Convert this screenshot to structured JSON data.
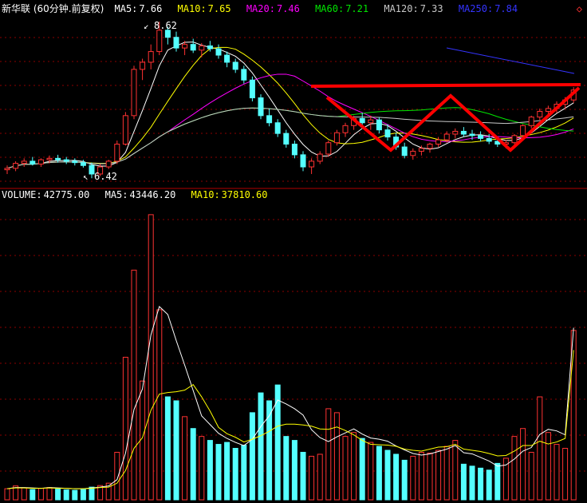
{
  "colors": {
    "background": "#000000",
    "up": "#ff3232",
    "down": "#54ffff",
    "ma5": "#ffffff",
    "ma10": "#ffff00",
    "ma20": "#ff00ff",
    "ma60": "#00e600",
    "ma120": "#c8c8c8",
    "ma250": "#3434ff",
    "grid": "#8b0000",
    "annotation": "#ff0000"
  },
  "header": {
    "title": "新华联 (60分钟.前复权)",
    "ma5_label": "MA5:",
    "ma5_value": "7.66",
    "ma10_label": "MA10:",
    "ma10_value": "7.65",
    "ma20_label": "MA20:",
    "ma20_value": "7.46",
    "ma60_label": "MA60:",
    "ma60_value": "7.21",
    "ma120_label": "MA120:",
    "ma120_value": "7.33",
    "ma250_label": "MA250:",
    "ma250_value": "7.84",
    "corner_icon": "diamond-icon"
  },
  "volume_header": {
    "volume_label": "VOLUME:",
    "volume_value": "42775.00",
    "ma5_label": "MA5:",
    "ma5_value": "43446.20",
    "ma10_label": "MA10:",
    "ma10_value": "37810.60"
  },
  "chart_data": {
    "type": "candlestick",
    "price_range": [
      6.3,
      8.7
    ],
    "volume_range": [
      0,
      75000
    ],
    "grid": true,
    "annotations": {
      "high_label": "8.62",
      "low_label": "6.42"
    },
    "ohlc": [
      [
        6.54,
        6.6,
        6.48,
        6.56
      ],
      [
        6.56,
        6.66,
        6.52,
        6.63
      ],
      [
        6.63,
        6.7,
        6.58,
        6.66
      ],
      [
        6.66,
        6.72,
        6.6,
        6.62
      ],
      [
        6.62,
        6.7,
        6.58,
        6.68
      ],
      [
        6.68,
        6.74,
        6.63,
        6.7
      ],
      [
        6.7,
        6.75,
        6.64,
        6.68
      ],
      [
        6.68,
        6.72,
        6.62,
        6.66
      ],
      [
        6.66,
        6.7,
        6.6,
        6.64
      ],
      [
        6.64,
        6.68,
        6.57,
        6.6
      ],
      [
        6.6,
        6.64,
        6.42,
        6.48
      ],
      [
        6.48,
        6.62,
        6.45,
        6.58
      ],
      [
        6.58,
        6.68,
        6.55,
        6.66
      ],
      [
        6.66,
        6.95,
        6.62,
        6.9
      ],
      [
        6.9,
        7.35,
        6.88,
        7.3
      ],
      [
        7.3,
        8.0,
        7.25,
        7.95
      ],
      [
        7.95,
        8.1,
        7.8,
        8.05
      ],
      [
        8.05,
        8.3,
        7.95,
        8.2
      ],
      [
        8.2,
        8.62,
        8.15,
        8.5
      ],
      [
        8.5,
        8.55,
        8.3,
        8.4
      ],
      [
        8.4,
        8.48,
        8.2,
        8.25
      ],
      [
        8.25,
        8.35,
        8.15,
        8.3
      ],
      [
        8.3,
        8.38,
        8.18,
        8.22
      ],
      [
        8.22,
        8.32,
        8.12,
        8.28
      ],
      [
        8.28,
        8.35,
        8.2,
        8.24
      ],
      [
        8.24,
        8.3,
        8.1,
        8.15
      ],
      [
        8.15,
        8.2,
        7.98,
        8.05
      ],
      [
        8.05,
        8.1,
        7.9,
        7.95
      ],
      [
        7.95,
        8.0,
        7.75,
        7.8
      ],
      [
        7.8,
        7.85,
        7.5,
        7.55
      ],
      [
        7.55,
        7.6,
        7.25,
        7.3
      ],
      [
        7.3,
        7.4,
        7.15,
        7.2
      ],
      [
        7.2,
        7.25,
        7.0,
        7.05
      ],
      [
        7.05,
        7.1,
        6.85,
        6.9
      ],
      [
        6.9,
        6.95,
        6.7,
        6.75
      ],
      [
        6.75,
        6.8,
        6.52,
        6.58
      ],
      [
        6.58,
        6.7,
        6.48,
        6.66
      ],
      [
        6.66,
        6.8,
        6.62,
        6.76
      ],
      [
        6.76,
        6.95,
        6.72,
        6.92
      ],
      [
        6.92,
        7.1,
        6.88,
        7.06
      ],
      [
        7.06,
        7.2,
        7.0,
        7.16
      ],
      [
        7.16,
        7.3,
        7.1,
        7.26
      ],
      [
        7.26,
        7.34,
        7.14,
        7.2
      ],
      [
        7.2,
        7.3,
        7.1,
        7.24
      ],
      [
        7.24,
        7.28,
        7.05,
        7.1
      ],
      [
        7.1,
        7.18,
        6.95,
        7.0
      ],
      [
        7.0,
        7.06,
        6.82,
        6.86
      ],
      [
        6.86,
        6.92,
        6.7,
        6.74
      ],
      [
        6.74,
        6.84,
        6.68,
        6.8
      ],
      [
        6.8,
        6.88,
        6.74,
        6.84
      ],
      [
        6.84,
        6.92,
        6.78,
        6.9
      ],
      [
        6.9,
        7.0,
        6.86,
        6.96
      ],
      [
        6.96,
        7.08,
        6.92,
        7.04
      ],
      [
        7.04,
        7.12,
        6.98,
        7.08
      ],
      [
        7.08,
        7.14,
        7.0,
        7.04
      ],
      [
        7.04,
        7.1,
        6.96,
        7.02
      ],
      [
        7.02,
        7.08,
        6.94,
        6.98
      ],
      [
        6.98,
        7.04,
        6.9,
        6.94
      ],
      [
        6.94,
        6.98,
        6.86,
        6.9
      ],
      [
        6.9,
        6.96,
        6.84,
        6.92
      ],
      [
        6.92,
        7.04,
        6.9,
        7.02
      ],
      [
        7.02,
        7.18,
        7.0,
        7.16
      ],
      [
        7.16,
        7.3,
        7.12,
        7.28
      ],
      [
        7.28,
        7.4,
        7.24,
        7.36
      ],
      [
        7.36,
        7.44,
        7.3,
        7.4
      ],
      [
        7.4,
        7.5,
        7.34,
        7.46
      ],
      [
        7.46,
        7.56,
        7.4,
        7.52
      ],
      [
        7.52,
        7.7,
        7.48,
        7.66
      ]
    ],
    "volume": [
      2800,
      3500,
      3000,
      2600,
      2900,
      3100,
      2700,
      2500,
      2400,
      2600,
      3200,
      3600,
      4200,
      12000,
      36000,
      58000,
      30000,
      72000,
      48000,
      26000,
      25000,
      21000,
      18000,
      16000,
      15000,
      14000,
      14500,
      13000,
      13800,
      22000,
      27000,
      25000,
      29000,
      16000,
      15000,
      12000,
      11000,
      11500,
      23000,
      22000,
      16000,
      17000,
      15500,
      14500,
      13500,
      12500,
      11500,
      10000,
      11000,
      12000,
      11800,
      12500,
      13500,
      15000,
      9000,
      8500,
      8000,
      7500,
      9200,
      10500,
      16000,
      18000,
      12000,
      26000,
      17000,
      14000,
      13000,
      42775
    ],
    "volume_ma5": [
      2800,
      3100,
      3100,
      3000,
      2900,
      3100,
      3000,
      2900,
      2800,
      2800,
      3000,
      3200,
      3500,
      5100,
      11800,
      22800,
      28000,
      41600,
      48800,
      46800,
      40200,
      34000,
      27600,
      21200,
      19000,
      16800,
      15500,
      14500,
      13700,
      15300,
      18500,
      21200,
      25200,
      24200,
      23000,
      21400,
      17700,
      15700,
      14700,
      15900,
      16900,
      17900,
      16600,
      15600,
      15300,
      14800,
      13600,
      12600,
      11700,
      11300,
      11600,
      12200,
      12800,
      13700,
      11900,
      11600,
      10700,
      9800,
      8500,
      8800,
      10300,
      12300,
      13200,
      16500,
      17800,
      17400,
      16400,
      43446
    ],
    "volume_ma10": [
      2800,
      3000,
      3000,
      2900,
      2900,
      3000,
      2900,
      2900,
      2800,
      2800,
      2900,
      3100,
      3200,
      4200,
      7400,
      13000,
      15700,
      22600,
      26700,
      27100,
      27300,
      27700,
      29100,
      26000,
      22400,
      18300,
      16700,
      15800,
      14600,
      15300,
      16200,
      17300,
      18600,
      19100,
      19100,
      18900,
      18600,
      17900,
      17800,
      18400,
      17500,
      16400,
      15000,
      14000,
      13900,
      13800,
      13500,
      12800,
      12500,
      12300,
      12800,
      13300,
      13400,
      14000,
      12800,
      12500,
      12200,
      11700,
      11100,
      11200,
      12300,
      13700,
      13700,
      14800,
      14100,
      14600,
      15500,
      37810
    ]
  }
}
